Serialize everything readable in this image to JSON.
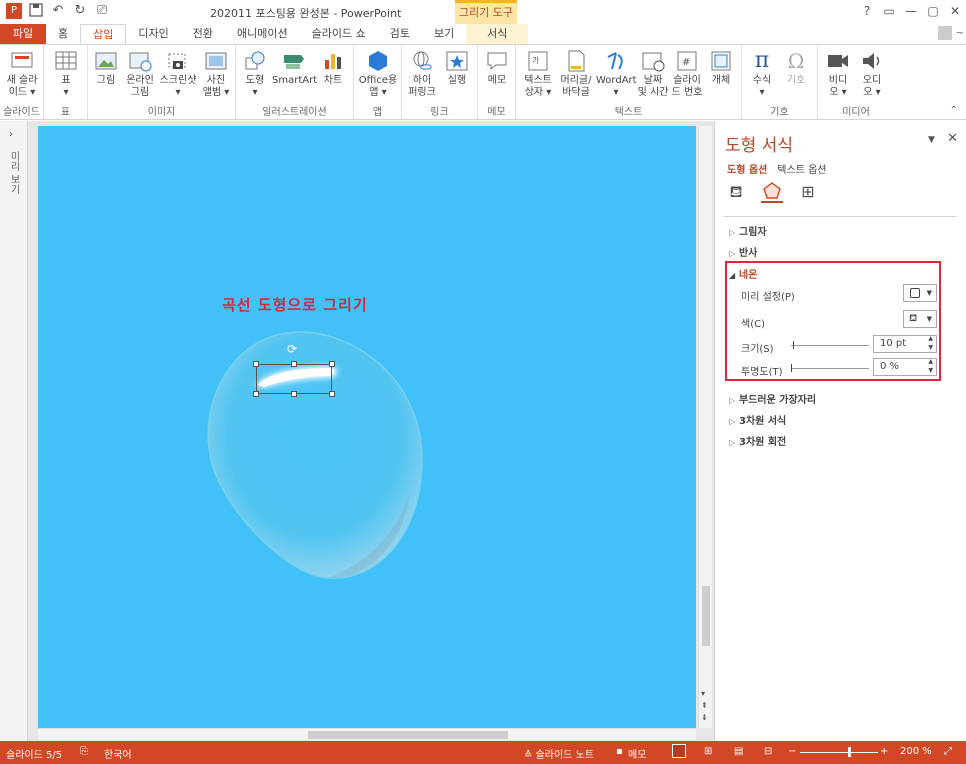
{
  "title": {
    "document": "202011 포스팅용 완성본 - PowerPoint",
    "context_tab_group": "그리기 도구",
    "user": "~"
  },
  "window_controls": [
    "?",
    "▭",
    "—",
    "▢",
    "✕"
  ],
  "tabs": [
    {
      "label": "파일",
      "state": "file"
    },
    {
      "label": "홈",
      "state": ""
    },
    {
      "label": "삽입",
      "state": "active"
    },
    {
      "label": "디자인",
      "state": ""
    },
    {
      "label": "전환",
      "state": ""
    },
    {
      "label": "애니메이션",
      "state": ""
    },
    {
      "label": "슬라이드 쇼",
      "state": ""
    },
    {
      "label": "검토",
      "state": ""
    },
    {
      "label": "보기",
      "state": ""
    },
    {
      "label": "서식",
      "state": "context"
    }
  ],
  "ribbon": {
    "groups": {
      "slides": "슬라이드",
      "tables": "표",
      "images": "이미지",
      "illustrations": "일러스트레이션",
      "apps": "앱",
      "links": "링크",
      "comments": "메모",
      "text": "텍스트",
      "symbols": "기호",
      "media": "미디어"
    },
    "buttons": {
      "new_slide": [
        "새 슬라",
        "이드 ▾"
      ],
      "table": [
        "표",
        "▾"
      ],
      "pictures": [
        "그림",
        ""
      ],
      "online_pictures": [
        "온라인",
        "그림"
      ],
      "screenshot": [
        "스크린샷",
        "▾"
      ],
      "photo_album": [
        "사진",
        "앨범 ▾"
      ],
      "shapes": [
        "도형",
        "▾"
      ],
      "smartart": [
        "SmartArt",
        ""
      ],
      "chart": [
        "차트",
        ""
      ],
      "office_apps": [
        "Office용",
        "앱 ▾"
      ],
      "hyperlink": [
        "하이",
        "퍼링크"
      ],
      "action": [
        "실행",
        ""
      ],
      "comment": [
        "메모",
        ""
      ],
      "textbox": [
        "텍스트",
        "상자 ▾"
      ],
      "header_footer": [
        "머리글/",
        "바닥글"
      ],
      "wordart": [
        "WordArt",
        "▾"
      ],
      "date_time": [
        "날짜",
        "및 시간"
      ],
      "slide_number": [
        "슬라이",
        "드 번호"
      ],
      "object": [
        "개체",
        ""
      ],
      "equation": [
        "수식",
        "▾"
      ],
      "symbol": [
        "기호",
        ""
      ],
      "video": [
        "비디",
        "오 ▾"
      ],
      "audio": [
        "오디",
        "오 ▾"
      ]
    }
  },
  "left_rail": {
    "label": "미리 보기"
  },
  "slide": {
    "heading": "곡선 도형으로 그리기",
    "background": "#41c1f8",
    "heading_color": "#d7263d"
  },
  "pane": {
    "title": "도형 서식",
    "subtabs": [
      "도형 옵션",
      "텍스트 옵션"
    ],
    "sections": {
      "shadow": "그림자",
      "reflection": "반사",
      "glow": "네온",
      "soft_edges": "부드러운 가장자리",
      "format_3d": "3차원 서식",
      "rotation_3d": "3차원 회전"
    },
    "glow": {
      "presets_label": "미리 설정(P)",
      "color_label": "색(C)",
      "size_label": "크기(S)",
      "size_value": "10 pt",
      "transparency_label": "투명도(T)",
      "transparency_value": "0 %"
    }
  },
  "status": {
    "slide": "슬라이드 5/5",
    "language": "한국어",
    "notes": "≙ 슬라이드 노트",
    "comments": "메모",
    "zoom": "200 %"
  },
  "colors": {
    "accent": "#d24726",
    "highlight_box": "#e32636"
  }
}
